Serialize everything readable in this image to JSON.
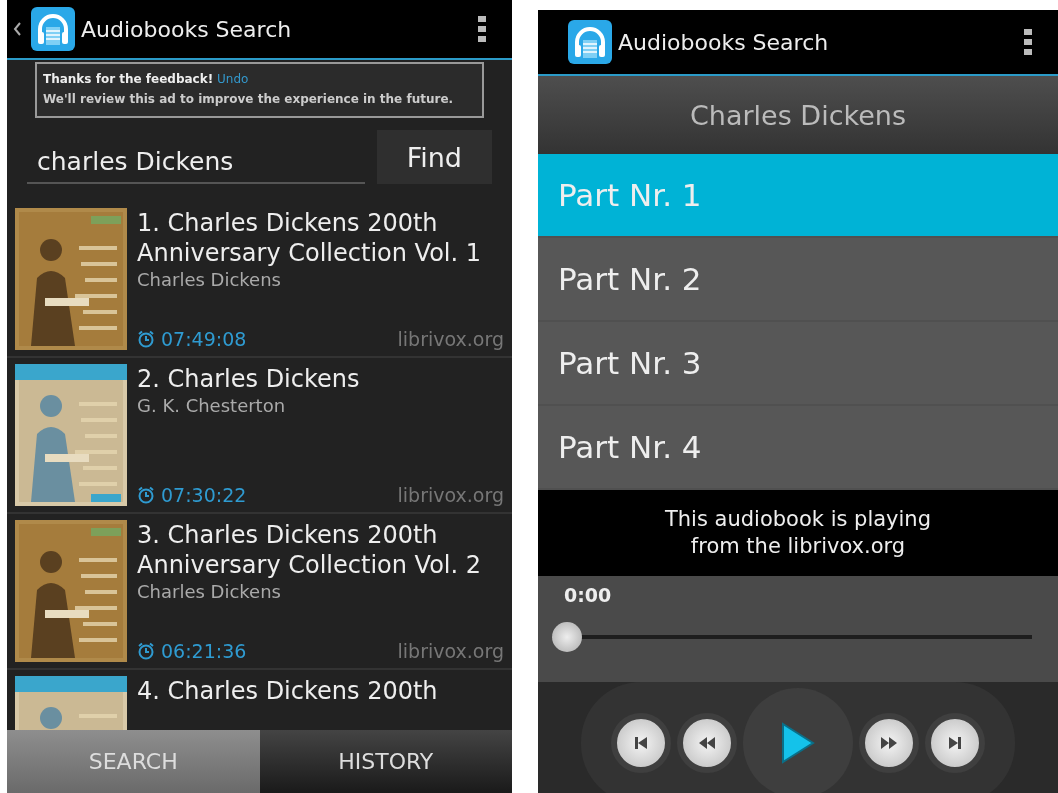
{
  "search_screen": {
    "app_bar": {
      "title": "Audiobooks Search",
      "show_back": true
    },
    "ad_notice": {
      "heading": "Thanks for the feedback!",
      "link": "Undo",
      "message": "We'll review this ad to improve the experience in the future."
    },
    "search": {
      "value": "charles Dickens",
      "button": "Find"
    },
    "results": [
      {
        "title": "1. Charles Dickens 200th Anniversary Collection Vol. 1",
        "author": "Charles Dickens",
        "duration": "07:49:08",
        "source": "librivox.org"
      },
      {
        "title": "2. Charles Dickens",
        "author": "G. K. Chesterton",
        "duration": "07:30:22",
        "source": "librivox.org"
      },
      {
        "title": "3. Charles Dickens 200th Anniversary Collection Vol. 2",
        "author": "Charles Dickens",
        "duration": "06:21:36",
        "source": "librivox.org"
      },
      {
        "title": "4. Charles Dickens 200th"
      }
    ],
    "tabs": [
      {
        "label": "SEARCH",
        "selected": true
      },
      {
        "label": "HISTORY",
        "selected": false
      }
    ]
  },
  "player_screen": {
    "app_bar": {
      "title": "Audiobooks Search",
      "show_back": false
    },
    "book_title": "Charles Dickens",
    "parts": [
      {
        "label": "Part Nr. 1",
        "selected": true
      },
      {
        "label": "Part Nr. 2",
        "selected": false
      },
      {
        "label": "Part Nr. 3",
        "selected": false
      },
      {
        "label": "Part Nr. 4",
        "selected": false
      }
    ],
    "source_banner": "This audiobook is playing from the librivox.org",
    "position": "0:00",
    "seek": {
      "level": 0
    },
    "controls": [
      {
        "kind": "previous"
      },
      {
        "kind": "rewind"
      },
      {
        "kind": "play"
      },
      {
        "kind": "forward"
      },
      {
        "kind": "next"
      }
    ]
  }
}
